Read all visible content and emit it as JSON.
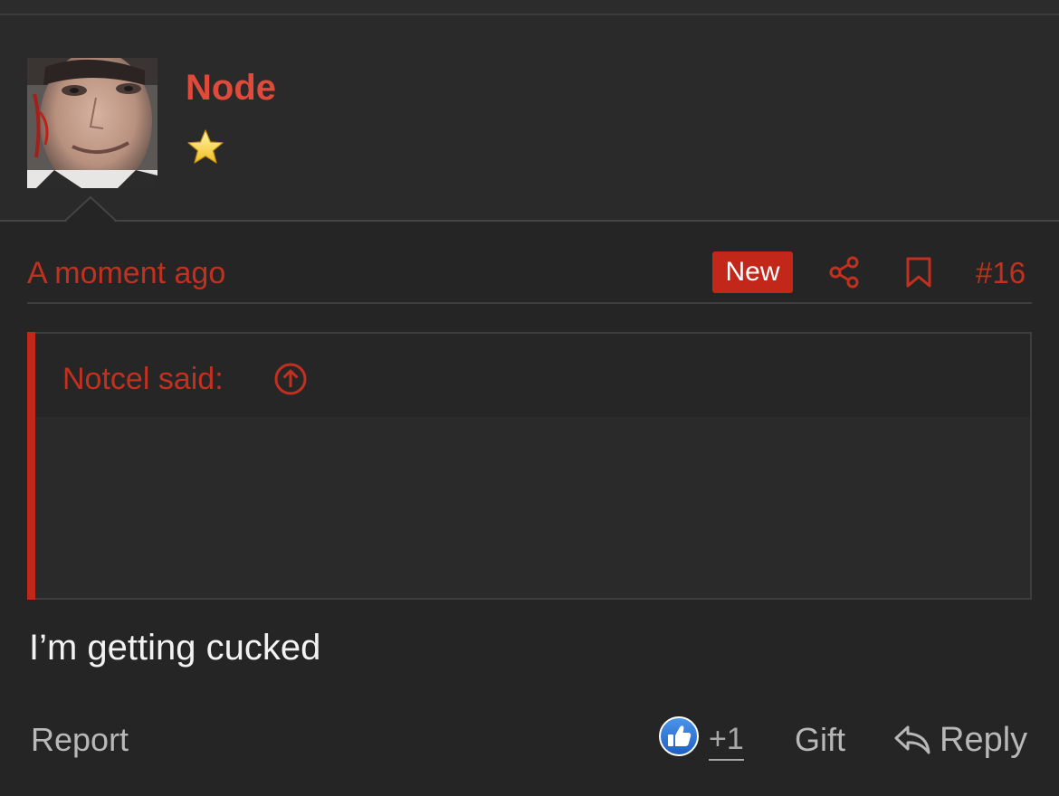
{
  "post": {
    "username": "Node",
    "rank_icon": "star-icon",
    "timestamp": "A moment ago",
    "badge": "New",
    "post_number": "#16",
    "body": "I’m getting cucked"
  },
  "quote": {
    "author_label": "Notcel said:",
    "expand_icon": "arrow-up-circle-icon"
  },
  "actions": {
    "report": "Report",
    "reaction_icon": "thumbs-up-icon",
    "reaction_count": "+1",
    "gift": "Gift",
    "reply": "Reply",
    "share_icon": "share-icon",
    "bookmark_icon": "bookmark-icon"
  },
  "colors": {
    "accent_red": "#c2301f",
    "username_red": "#e04a3a",
    "badge_red": "#c3271a",
    "background": "#252525",
    "muted_text": "#b8b8b8",
    "like_blue": "#2f7ad8"
  }
}
